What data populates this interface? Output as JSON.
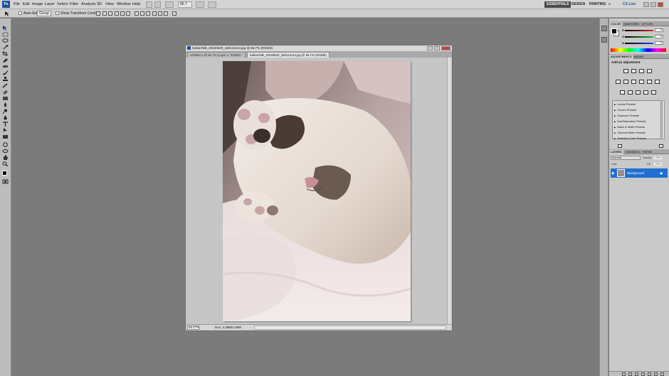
{
  "app": {
    "logo": "Ps"
  },
  "menubar": {
    "items": [
      "File",
      "Edit",
      "Image",
      "Layer",
      "Select",
      "Filter",
      "Analysis",
      "3D",
      "View",
      "Window",
      "Help"
    ],
    "zoom": "66.7",
    "workspaces": [
      "ESSENTIALS",
      "DESIGN",
      "PAINTING"
    ],
    "more": "»",
    "cslive": "CS Live"
  },
  "options": {
    "auto_select_label": "Auto-Select:",
    "auto_select_value": "Group",
    "show_transform_label": "Show Transform Controls"
  },
  "document": {
    "title": "KakaoTalk_20220620_160144114.jpg @ 66.7% (RGB/8)",
    "tabs": [
      "Untitled-1 @ 66.7% (Layer 2, RGB/8) *",
      "KakaoTalk_20220620_160144114.jpg @ 66.7% (RGB/8)"
    ],
    "status_zoom": "66.67%",
    "status_doc": "Doc: 4.49M/4.49M"
  },
  "panels": {
    "color_tabs": [
      "COLOR",
      "SWATCHES",
      "STYLES"
    ],
    "sliders": [
      {
        "label": "R",
        "value": "0",
        "color": "#e02020"
      },
      {
        "label": "G",
        "value": "0",
        "color": "#20b020"
      },
      {
        "label": "B",
        "value": "0",
        "color": "#2040e0"
      }
    ],
    "adj_tabs": [
      "ADJUSTMENTS",
      "MASKS"
    ],
    "adj_title": "Add an adjustment",
    "presets": [
      "Levels Presets",
      "Curves Presets",
      "Exposure Presets",
      "Hue/Saturation Presets",
      "Black & White Presets",
      "Channel Mixer Presets",
      "Selective Color Presets"
    ],
    "layer_tabs": [
      "LAYERS",
      "CHANNELS",
      "PATHS"
    ],
    "blend_mode": "Normal",
    "opacity_label": "Opacity:",
    "opacity_value": "100%",
    "lock_label": "Lock:",
    "fill_label": "Fill:",
    "fill_value": "100%",
    "layer_name": "Background"
  }
}
